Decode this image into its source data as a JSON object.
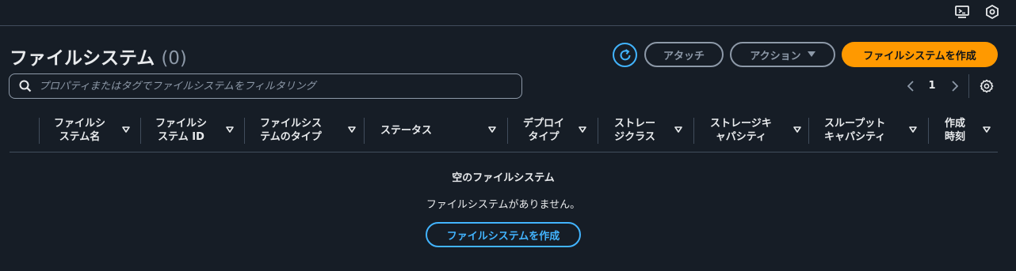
{
  "topbar": {
    "icons": [
      "cloudshell-icon",
      "settings-hex-icon"
    ]
  },
  "header": {
    "title": "ファイルシステム",
    "count": "(0)"
  },
  "actions": {
    "attach_label": "アタッチ",
    "actions_label": "アクション",
    "create_label": "ファイルシステムを作成"
  },
  "search": {
    "placeholder": "プロパティまたはタグでファイルシステムをフィルタリング",
    "value": ""
  },
  "pagination": {
    "current_page": "1"
  },
  "table": {
    "columns": [
      "ファイルシ\nステム名",
      "ファイルシ\nステム ID",
      "ファイルシス\nテムのタイプ",
      "ステータス",
      "デプロイ\nタイプ",
      "ストレー\nジクラス",
      "ストレージキ\nャパシティ",
      "スループット\nキャパシティ",
      "作成\n時刻"
    ]
  },
  "empty_state": {
    "title": "空のファイルシステム",
    "description": "ファイルシステムがありません。",
    "button_label": "ファイルシステムを作成"
  },
  "colors": {
    "background": "#161d26",
    "accent": "#ff9900",
    "link": "#42b4ff",
    "border": "#414d5c"
  }
}
